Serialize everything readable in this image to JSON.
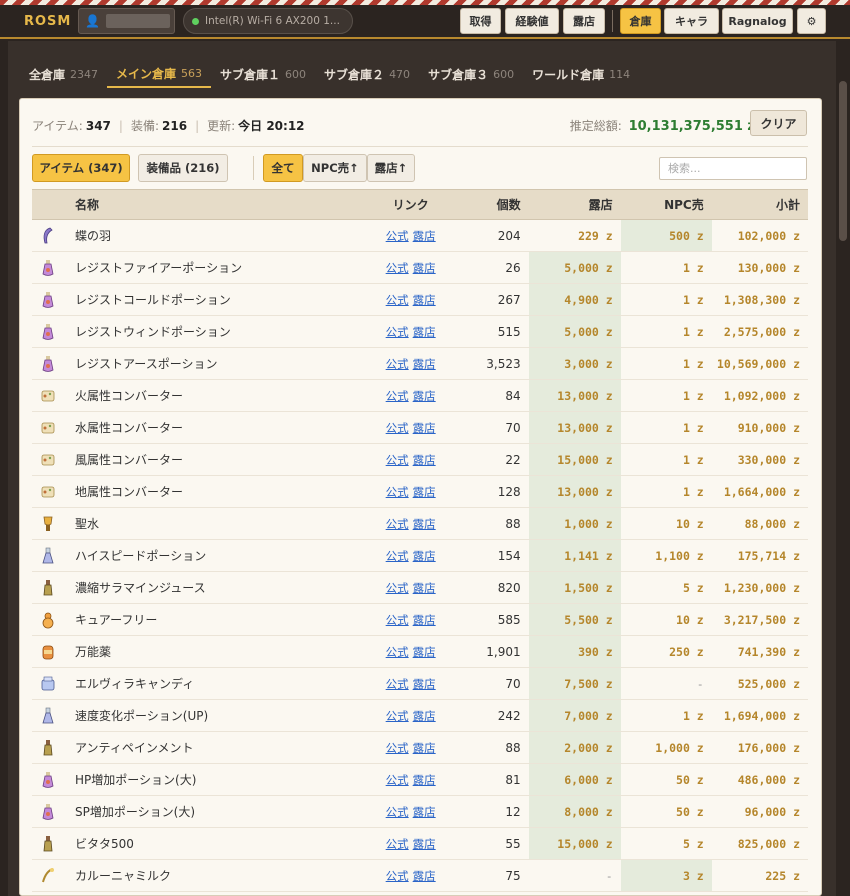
{
  "app": {
    "title": "ROSM"
  },
  "network": {
    "label": "Intel(R) Wi-Fi 6 AX200 1..."
  },
  "topnav": {
    "buttons": [
      "取得",
      "経験値",
      "露店"
    ],
    "right_buttons": [
      "倉庫",
      "キャラ",
      "Ragnalog"
    ],
    "active": "倉庫",
    "settings_icon": "gear-icon",
    "user_icon": "user-icon"
  },
  "tabs": [
    {
      "label": "全倉庫",
      "count": "2347",
      "active": false
    },
    {
      "label": "メイン倉庫",
      "count": "563",
      "active": true
    },
    {
      "label": "サブ倉庫１",
      "count": "600",
      "active": false
    },
    {
      "label": "サブ倉庫２",
      "count": "470",
      "active": false
    },
    {
      "label": "サブ倉庫３",
      "count": "600",
      "active": false
    },
    {
      "label": "ワールド倉庫",
      "count": "114",
      "active": false
    }
  ],
  "summary": {
    "items_label": "アイテム:",
    "items_value": "347",
    "equip_label": "装備:",
    "equip_value": "216",
    "updated_label": "更新:",
    "updated_value": "今日 20:12",
    "total_label": "推定総額:",
    "total_value": "10,131,375,551 z",
    "clear_label": "クリア"
  },
  "filters": {
    "item_tab": "アイテム (347)",
    "equip_tab": "装備品 (216)",
    "sort_all": "全て",
    "sort_npc": "NPC売↑",
    "sort_shop": "露店↑",
    "search_placeholder": "検索..."
  },
  "table": {
    "headers": {
      "name": "名称",
      "link": "リンク",
      "qty": "個数",
      "shop": "露店",
      "npc": "NPC売",
      "subtotal": "小計"
    },
    "link_official": "公式",
    "link_shop": "露店",
    "rows": [
      {
        "icon": "feather-icon",
        "name": "蝶の羽",
        "qty": "204",
        "shop": "229 z",
        "npc": "500 z",
        "sub": "102,000 z",
        "best": "npc"
      },
      {
        "icon": "potion-icon",
        "name": "レジストファイアーポーション",
        "qty": "26",
        "shop": "5,000 z",
        "npc": "1 z",
        "sub": "130,000 z",
        "best": "shop"
      },
      {
        "icon": "potion-icon",
        "name": "レジストコールドポーション",
        "qty": "267",
        "shop": "4,900 z",
        "npc": "1 z",
        "sub": "1,308,300 z",
        "best": "shop"
      },
      {
        "icon": "potion-icon",
        "name": "レジストウィンドポーション",
        "qty": "515",
        "shop": "5,000 z",
        "npc": "1 z",
        "sub": "2,575,000 z",
        "best": "shop"
      },
      {
        "icon": "potion-icon",
        "name": "レジストアースポーション",
        "qty": "3,523",
        "shop": "3,000 z",
        "npc": "1 z",
        "sub": "10,569,000 z",
        "best": "shop"
      },
      {
        "icon": "scroll-icon",
        "name": "火属性コンバーター",
        "qty": "84",
        "shop": "13,000 z",
        "npc": "1 z",
        "sub": "1,092,000 z",
        "best": "shop"
      },
      {
        "icon": "scroll-icon",
        "name": "水属性コンバーター",
        "qty": "70",
        "shop": "13,000 z",
        "npc": "1 z",
        "sub": "910,000 z",
        "best": "shop"
      },
      {
        "icon": "scroll-icon",
        "name": "風属性コンバーター",
        "qty": "22",
        "shop": "15,000 z",
        "npc": "1 z",
        "sub": "330,000 z",
        "best": "shop"
      },
      {
        "icon": "scroll-icon",
        "name": "地属性コンバーター",
        "qty": "128",
        "shop": "13,000 z",
        "npc": "1 z",
        "sub": "1,664,000 z",
        "best": "shop"
      },
      {
        "icon": "holy-water-icon",
        "name": "聖水",
        "qty": "88",
        "shop": "1,000 z",
        "npc": "10 z",
        "sub": "88,000 z",
        "best": "shop"
      },
      {
        "icon": "flask-icon",
        "name": "ハイスピードポーション",
        "qty": "154",
        "shop": "1,141 z",
        "npc": "1,100 z",
        "sub": "175,714 z",
        "best": "shop"
      },
      {
        "icon": "bottle-icon",
        "name": "濃縮サラマインジュース",
        "qty": "820",
        "shop": "1,500 z",
        "npc": "5 z",
        "sub": "1,230,000 z",
        "best": "shop"
      },
      {
        "icon": "gourd-icon",
        "name": "キュアーフリー",
        "qty": "585",
        "shop": "5,500 z",
        "npc": "10 z",
        "sub": "3,217,500 z",
        "best": "shop"
      },
      {
        "icon": "jar-icon",
        "name": "万能薬",
        "qty": "1,901",
        "shop": "390 z",
        "npc": "250 z",
        "sub": "741,390 z",
        "best": "shop"
      },
      {
        "icon": "candy-icon",
        "name": "エルヴィラキャンディ",
        "qty": "70",
        "shop": "7,500 z",
        "npc": "-",
        "sub": "525,000 z",
        "best": "shop"
      },
      {
        "icon": "flask-icon",
        "name": "速度変化ポーション(UP)",
        "qty": "242",
        "shop": "7,000 z",
        "npc": "1 z",
        "sub": "1,694,000 z",
        "best": "shop"
      },
      {
        "icon": "bottle-icon",
        "name": "アンティペインメント",
        "qty": "88",
        "shop": "2,000 z",
        "npc": "1,000 z",
        "sub": "176,000 z",
        "best": "shop"
      },
      {
        "icon": "potion-icon",
        "name": "HP増加ポーション(大)",
        "qty": "81",
        "shop": "6,000 z",
        "npc": "50 z",
        "sub": "486,000 z",
        "best": "shop"
      },
      {
        "icon": "potion-icon",
        "name": "SP増加ポーション(大)",
        "qty": "12",
        "shop": "8,000 z",
        "npc": "50 z",
        "sub": "96,000 z",
        "best": "shop"
      },
      {
        "icon": "bottle-icon",
        "name": "ビタタ500",
        "qty": "55",
        "shop": "15,000 z",
        "npc": "5 z",
        "sub": "825,000 z",
        "best": "shop"
      },
      {
        "icon": "milk-icon",
        "name": "カルーニャミルク",
        "qty": "75",
        "shop": "-",
        "npc": "3 z",
        "sub": "225 z",
        "best": "npc"
      }
    ]
  },
  "colors": {
    "accent": "#f6c344",
    "money": "#b5862b",
    "total": "#2e7d32",
    "best_bg": "#e5ebdc",
    "link": "#2a64c8"
  }
}
